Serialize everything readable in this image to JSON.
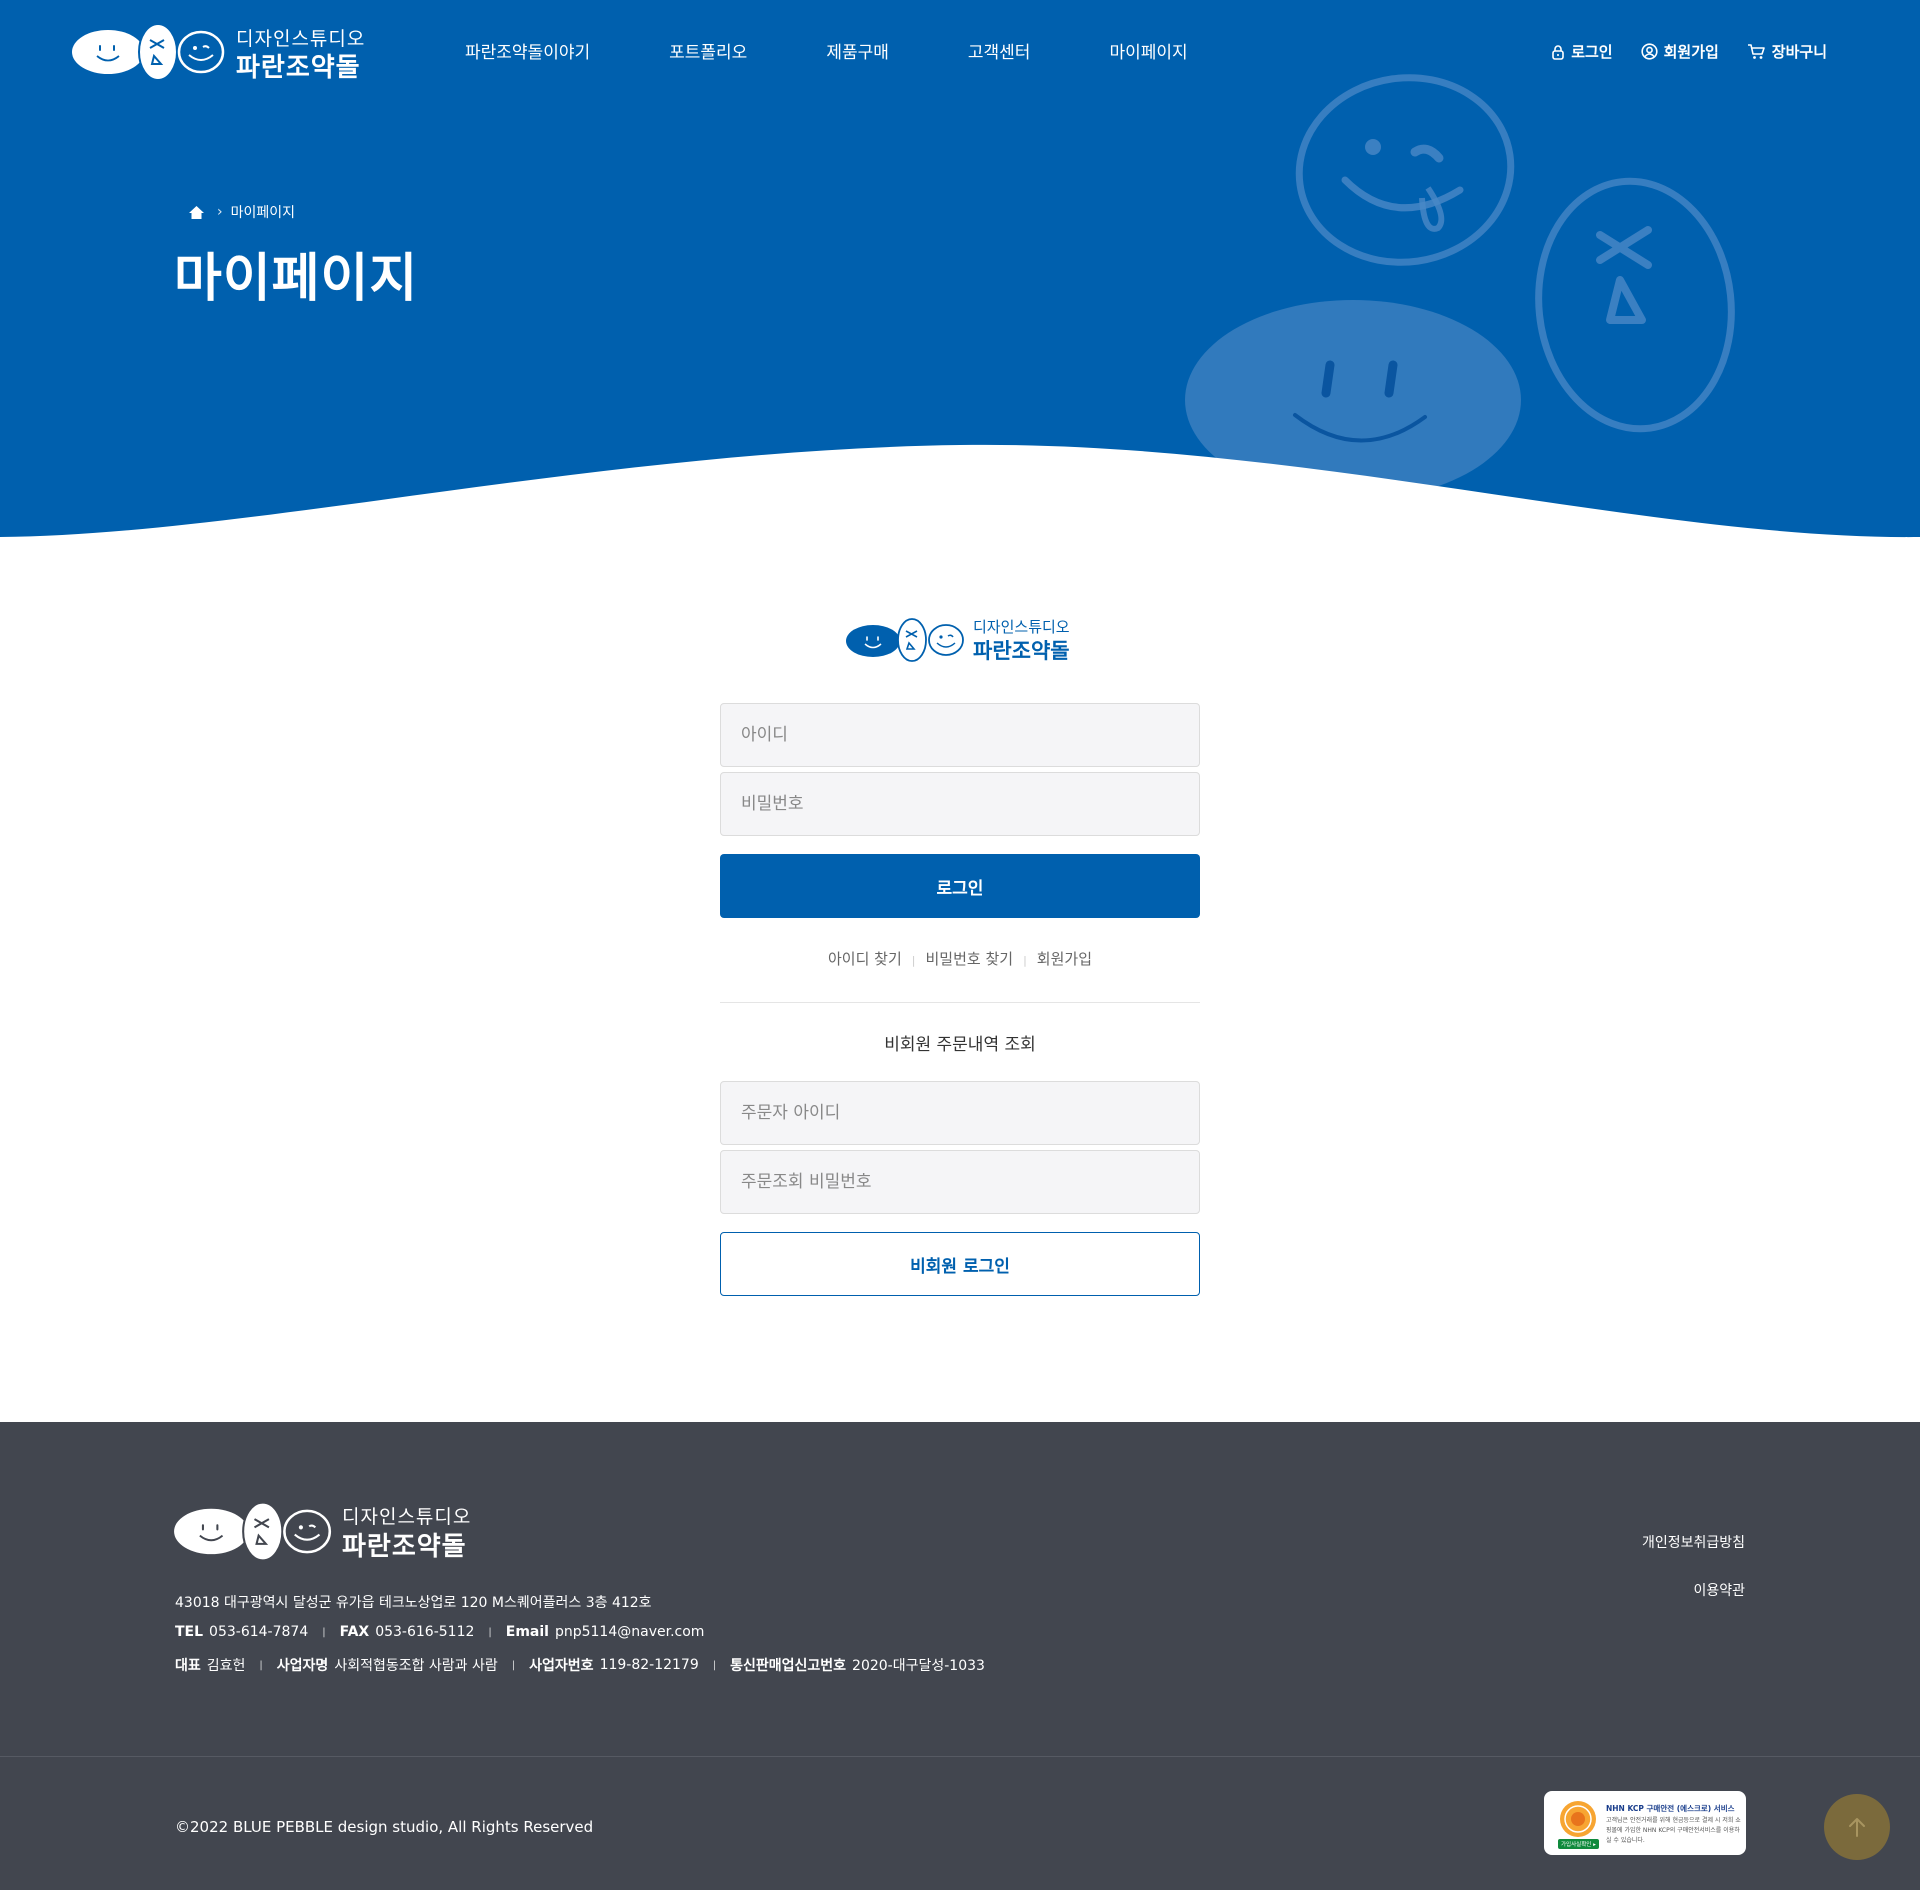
{
  "brand": {
    "name_small": "디자인스튜디오",
    "name_big": "파란조약돌",
    "color_primary": "#0060ae",
    "color_footer": "#42464f"
  },
  "nav": {
    "items": [
      {
        "label": "파란조약돌이야기"
      },
      {
        "label": "포트폴리오"
      },
      {
        "label": "제품구매"
      },
      {
        "label": "고객센터"
      },
      {
        "label": "마이페이지"
      }
    ]
  },
  "utility": {
    "login": {
      "label": "로그인",
      "icon": "lock-icon"
    },
    "signup": {
      "label": "회원가입",
      "icon": "user-icon"
    },
    "cart": {
      "label": "장바구니",
      "icon": "cart-icon"
    }
  },
  "breadcrumb": {
    "home_icon": "home-icon",
    "current": "마이페이지"
  },
  "page_title": "마이페이지",
  "login": {
    "id_placeholder": "아이디",
    "password_placeholder": "비밀번호",
    "submit_label": "로그인",
    "links": {
      "find_id": "아이디 찾기",
      "find_password": "비밀번호 찾기",
      "signup": "회원가입"
    }
  },
  "guest": {
    "title": "비회원 주문내역 조회",
    "orderer_id_placeholder": "주문자 아이디",
    "order_password_placeholder": "주문조회 비밀번호",
    "submit_label": "비회원 로그인"
  },
  "footer": {
    "address": "43018 대구광역시 달성군 유가읍 테크노상업로 120 M스퀘어플러스 3층 412호",
    "tel_label": "TEL",
    "tel": "053-614-7874",
    "fax_label": "FAX",
    "fax": "053-616-5112",
    "email_label": "Email",
    "email": "pnp5114@naver.com",
    "ceo_label": "대표",
    "ceo": "김효헌",
    "company_label": "사업자명",
    "company": "사회적협동조합 사람과 사람",
    "bizno_label": "사업자번호",
    "bizno": "119-82-12179",
    "mailorder_label": "통신판매업신고번호",
    "mailorder": "2020-대구달성-1033",
    "privacy": "개인정보취급방침",
    "terms": "이용약관",
    "copyright": "©2022 BLUE PEBBLE design studio, All Rights Reserved",
    "kcp": {
      "title": "NHN KCP 구매안전 (에스크로) 서비스",
      "body": "고객님은 안전거래를 위해 현금등으로 결제 시 저희 쇼핑몰에 가입한 NHN KCP의 구매안전서비스를 이용하실 수 있습니다.",
      "tag": "가입사실확인 ▸"
    },
    "top_icon": "arrow-up-icon"
  }
}
